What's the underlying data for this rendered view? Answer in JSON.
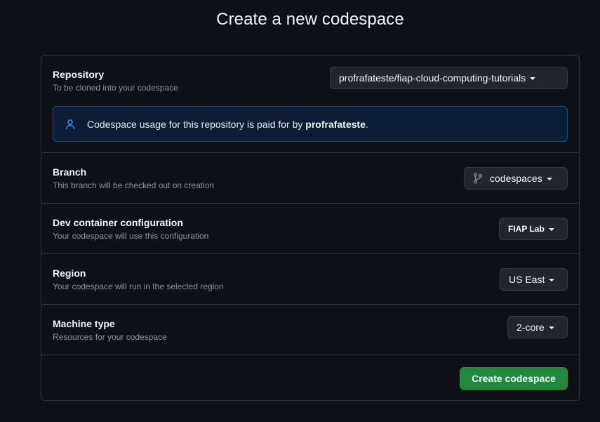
{
  "page": {
    "title": "Create a new codespace"
  },
  "repository": {
    "title": "Repository",
    "description": "To be cloned into your codespace",
    "selected": "profrafateste/fiap-cloud-computing-tutorials"
  },
  "notice": {
    "text": "Codespace usage for this repository is paid for by",
    "owner": "profrafateste",
    "suffix": "."
  },
  "branch": {
    "title": "Branch",
    "description": "This branch will be checked out on creation",
    "selected": "codespaces"
  },
  "devcontainer": {
    "title": "Dev container configuration",
    "description": "Your codespace will use this configuration",
    "selected": "FIAP Lab"
  },
  "region": {
    "title": "Region",
    "description": "Your codespace will run in the selected region",
    "selected": "US East"
  },
  "machine": {
    "title": "Machine type",
    "description": "Resources for your codespace",
    "selected": "2-core"
  },
  "actions": {
    "create_label": "Create codespace"
  },
  "colors": {
    "background": "#0d1117",
    "primary_button": "#1f883d",
    "notice_bg": "#0b1d36",
    "accent_blue": "#4493f8"
  },
  "icons": {
    "notice": "person-icon",
    "branch": "git-branch-icon",
    "dropdown": "caret-down-icon"
  }
}
